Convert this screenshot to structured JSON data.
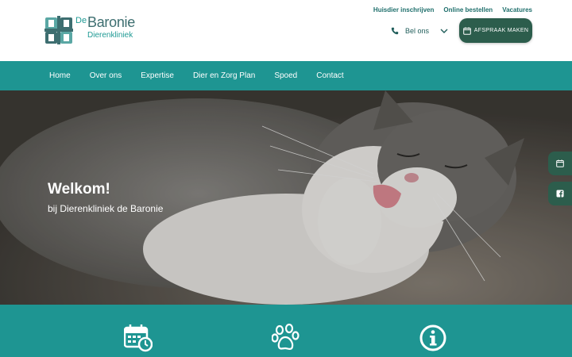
{
  "brand": {
    "de": "De",
    "name": "Baronie",
    "subtitle": "Dierenkliniek"
  },
  "toplinks": [
    {
      "label": "Huisdier inschrijven"
    },
    {
      "label": "Online bestellen"
    },
    {
      "label": "Vacatures"
    }
  ],
  "header": {
    "phone_label": "Bel ons",
    "cta_label": "AFSPRAAK MAKEN"
  },
  "nav": [
    {
      "label": "Home"
    },
    {
      "label": "Over ons"
    },
    {
      "label": "Expertise"
    },
    {
      "label": "Dier en Zorg Plan"
    },
    {
      "label": "Spoed"
    },
    {
      "label": "Contact"
    }
  ],
  "hero": {
    "title": "Welkom!",
    "subtitle": "bij Dierenkliniek de Baronie"
  },
  "side_buttons": [
    {
      "icon": "calendar-icon"
    },
    {
      "icon": "facebook-icon"
    }
  ],
  "features": [
    {
      "icon": "calendar-clock-icon"
    },
    {
      "icon": "paw-icon"
    },
    {
      "icon": "info-icon"
    }
  ],
  "colors": {
    "teal": "#1e9592",
    "dark_green": "#2c5d4c",
    "logo_text": "#3d6e70"
  }
}
